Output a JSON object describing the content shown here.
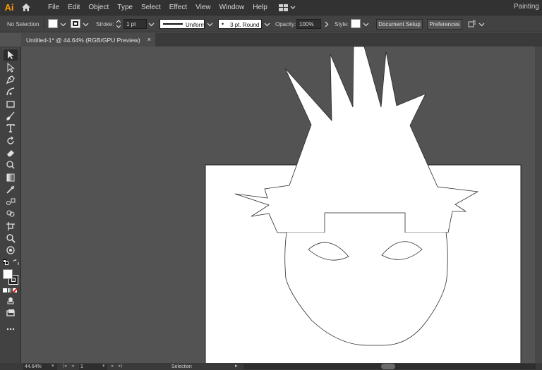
{
  "app": {
    "logo": "Ai",
    "workspace": "Painting"
  },
  "menu": [
    "File",
    "Edit",
    "Object",
    "Type",
    "Select",
    "Effect",
    "View",
    "Window",
    "Help"
  ],
  "control_bar": {
    "selection_status": "No Selection",
    "stroke_label": "Stroke:",
    "stroke_weight": "1 pt",
    "profile": "Uniform",
    "brush": "3 pt. Round",
    "opacity_label": "Opacity:",
    "opacity_value": "100%",
    "style_label": "Style:",
    "document_setup": "Document Setup",
    "preferences": "Preferences"
  },
  "document_tab": {
    "title": "Untitled-1* @ 44.64% (RGB/GPU Preview)",
    "close": "×"
  },
  "status_bar": {
    "zoom": "44.64%",
    "page": "1",
    "tool": "Selection"
  },
  "tools": [
    "selection-tool",
    "direct-selection-tool",
    "pen-tool",
    "curvature-tool",
    "rectangle-tool",
    "paintbrush-tool",
    "type-tool",
    "rotate-tool",
    "eraser-tool",
    "warp-tool",
    "gradient-tool",
    "eyedropper-tool",
    "blend-tool",
    "shape-builder-tool",
    "artboard-tool",
    "zoom-tool",
    "hand-tool",
    "default-colors",
    "swap-colors",
    "fill-stroke",
    "color-modes",
    "draw-modes",
    "screen-mode",
    "more-tools"
  ],
  "colors": {
    "menubar": "#323232",
    "panel": "#424242",
    "canvas": "#535353",
    "artboard": "#ffffff",
    "logo": "#ff9a00"
  }
}
